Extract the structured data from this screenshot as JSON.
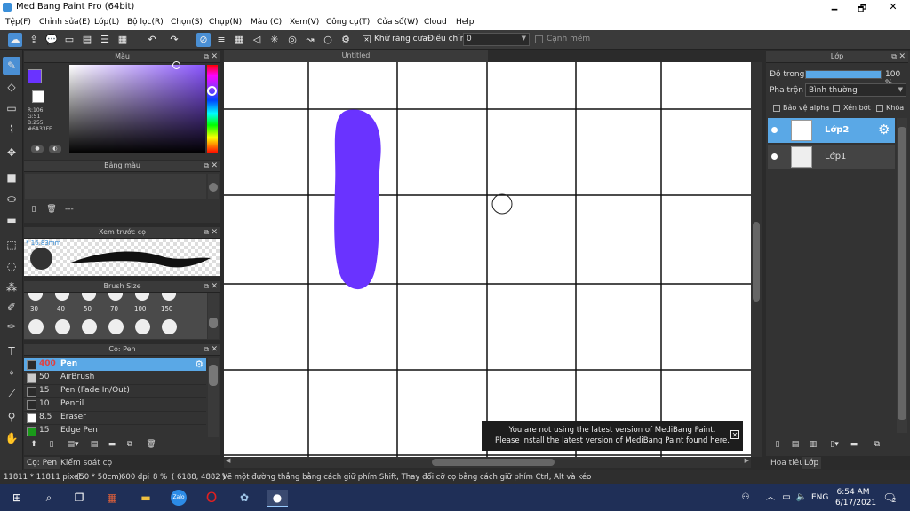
{
  "window": {
    "title": "MediBang Paint Pro (64bit)",
    "minimize": "🗕",
    "maximize": "🗗",
    "close": "✕"
  },
  "menu": [
    "Tệp(F)",
    "Chỉnh sửa(E)",
    "Lớp(L)",
    "Bộ lọc(R)",
    "Chọn(S)",
    "Chụp(N)",
    "Màu (C)",
    "Xem(V)",
    "Công cụ(T)",
    "Cửa sổ(W)",
    "Cloud",
    "Help"
  ],
  "toolbar": {
    "antialias_label": "Khử răng cưa",
    "correction_label": "Điều chỉnh",
    "correction_value": "0",
    "margin_label": "Cạnh mềm"
  },
  "color_panel": {
    "title": "Màu",
    "r": "R:106",
    "g": "G:51",
    "b": "B:255",
    "hex": "#6A33FF",
    "current_color": "#6a33ff"
  },
  "palette_panel": {
    "title": "Bảng màu",
    "value": "---"
  },
  "brush_preview": {
    "title": "Xem trước cọ",
    "size": "* 16.83mm"
  },
  "brush_size": {
    "title": "Brush Size",
    "sizes": [
      "30",
      "40",
      "50",
      "70",
      "100",
      "150"
    ]
  },
  "brush_panel": {
    "title": "Cọ: Pen",
    "items": [
      {
        "size": "400",
        "name": "Pen",
        "color": "#2a2a2a",
        "selected": true
      },
      {
        "size": "50",
        "name": "AirBrush",
        "color": "#cccccc",
        "selected": false
      },
      {
        "size": "15",
        "name": "Pen (Fade In/Out)",
        "color": "#2a2a2a",
        "selected": false
      },
      {
        "size": "10",
        "name": "Pencil",
        "color": "#2a2a2a",
        "selected": false
      },
      {
        "size": "8.5",
        "name": "Eraser",
        "color": "#ffffff",
        "selected": false
      },
      {
        "size": "15",
        "name": "Edge Pen",
        "color": "#1a9a1a",
        "selected": false
      }
    ]
  },
  "left_tabs": [
    "Cọ: Pen",
    "Kiểm soát cọ"
  ],
  "canvas": {
    "title": "Untitled",
    "stroke_color": "#6a33ff"
  },
  "notification": {
    "line1": "You are not using the latest version of MediBang Paint.",
    "line2": "Please install the latest version of MediBang Paint found here."
  },
  "layer_panel": {
    "title": "Lớp",
    "opacity_label": "Độ trong",
    "opacity_value": "100 %",
    "opacity_fraction": 1.0,
    "blend_label": "Pha trộn",
    "blend_value": "Bình thường",
    "protect_alpha": "Bảo vệ alpha",
    "clipping": "Xén bớt",
    "lock": "Khóa",
    "layers": [
      {
        "name": "Lớp2",
        "selected": true
      },
      {
        "name": "Lớp1",
        "selected": false
      }
    ],
    "tabs": [
      "Hoa tiêu",
      "Lớp"
    ]
  },
  "statusbar": {
    "pixels": "11811 * 11811 pixel",
    "size_cm": "(50 * 50cm)",
    "dpi": "600 dpi",
    "zoom": "8 %",
    "coords": "( 6188, 4882 )",
    "hint": "Vẽ một đường thẳng bằng cách giữ phím Shift, Thay đổi cỡ cọ bằng cách giữ phím Ctrl, Alt và kéo"
  },
  "taskbar": {
    "time": "6:54 AM",
    "date": "6/17/2021",
    "lang": "ENG",
    "notif_count": "2"
  }
}
